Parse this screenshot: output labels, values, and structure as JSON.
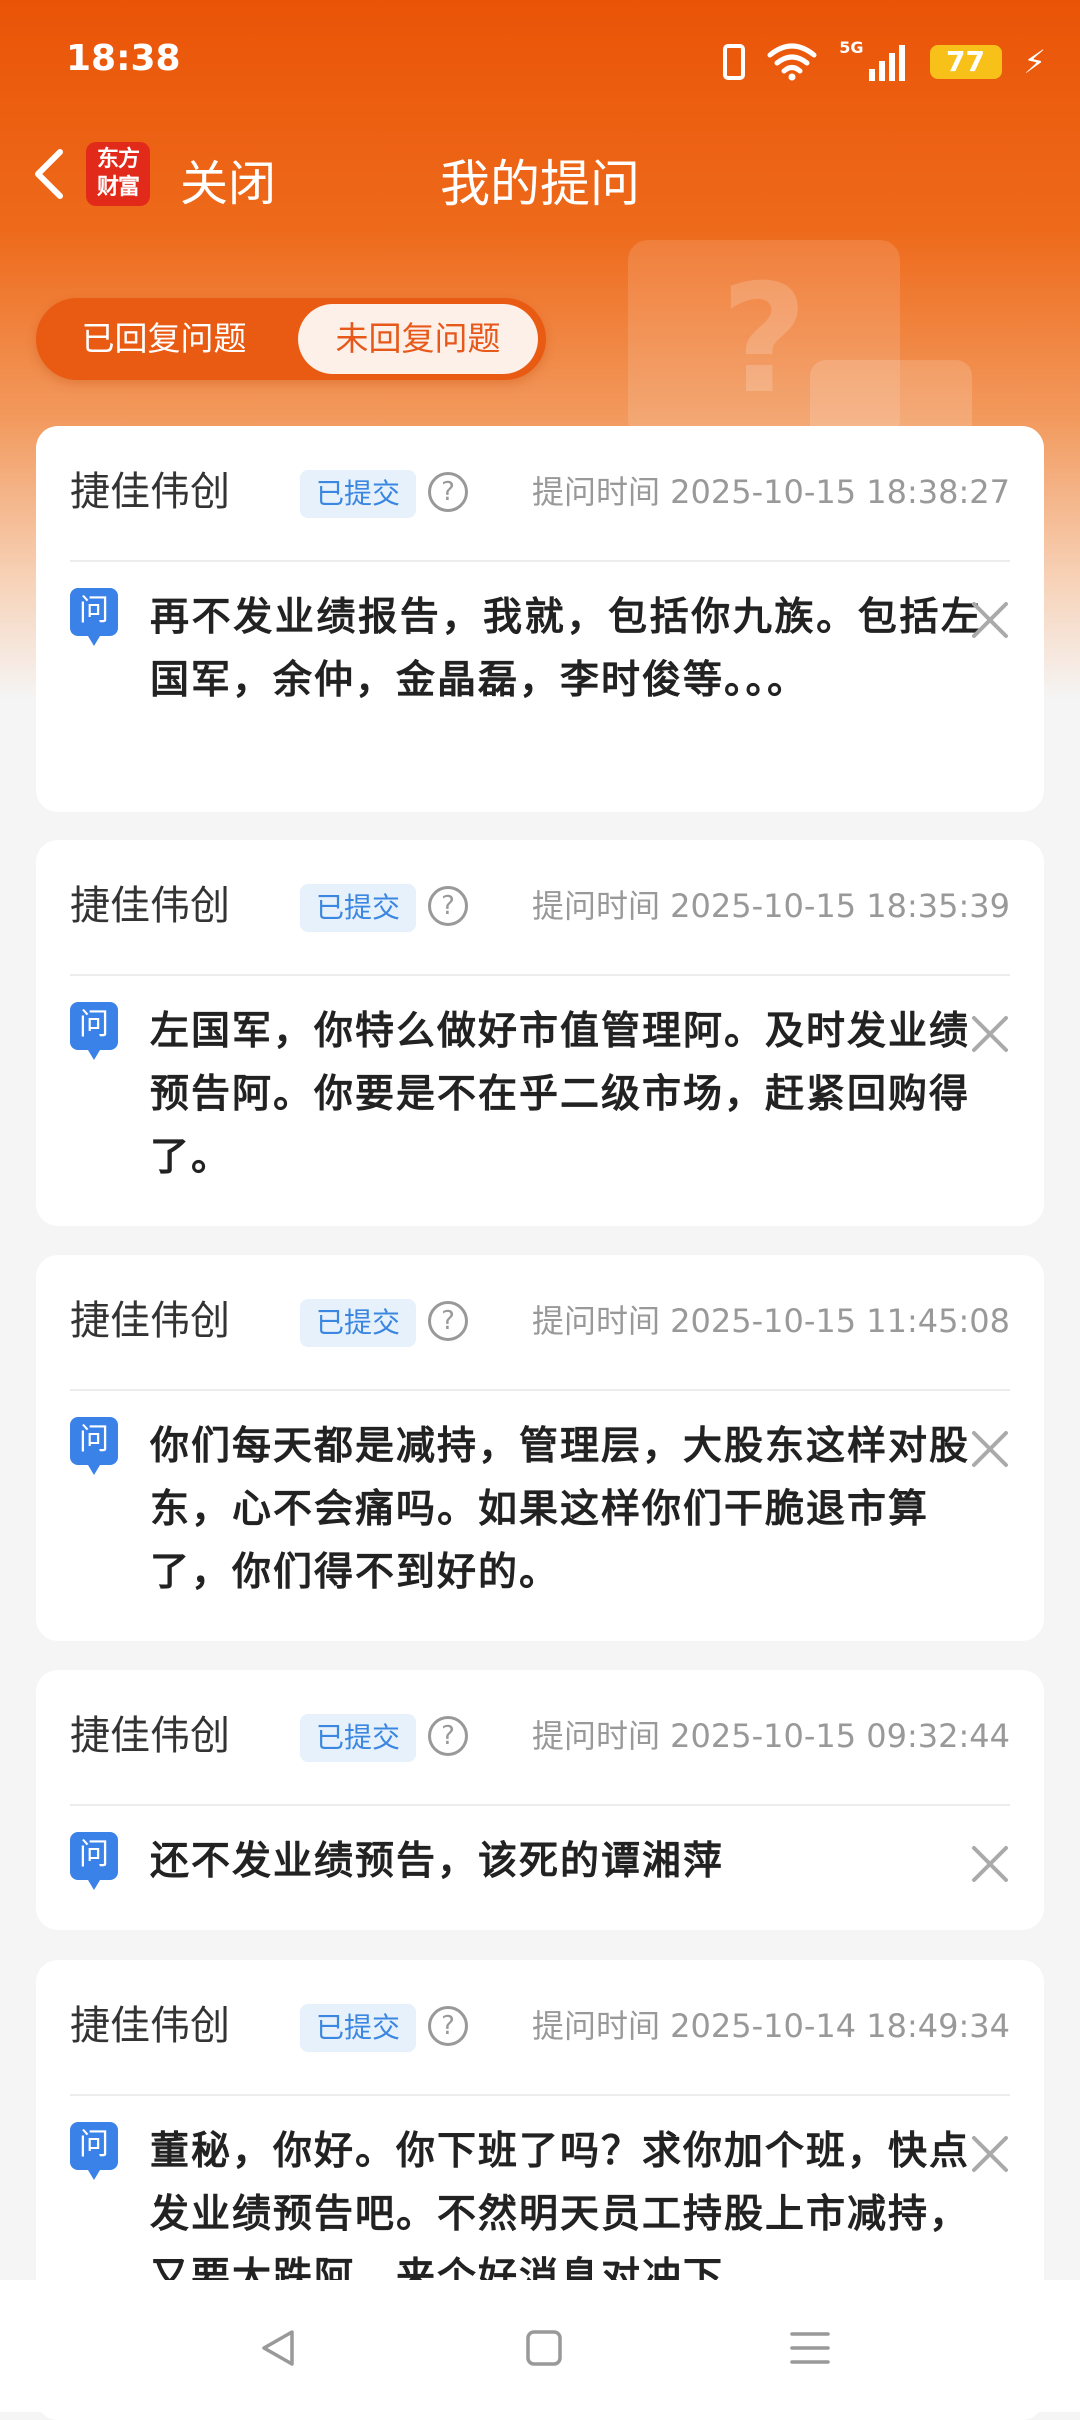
{
  "status_bar": {
    "time": "18:38",
    "network": "5G",
    "battery": "77",
    "icons": [
      "vibrate-icon",
      "wifi-icon",
      "signal-icon",
      "battery-icon",
      "charging-icon"
    ]
  },
  "header": {
    "logo_line1": "东方",
    "logo_line2": "财富",
    "close_label": "关闭",
    "title": "我的提问"
  },
  "tabs": {
    "answered": "已回复问题",
    "unanswered": "未回复问题",
    "active": "unanswered"
  },
  "questions": [
    {
      "company": "捷佳伟创",
      "status": "已提交",
      "time": "提问时间 2025-10-15 18:38:27",
      "icon_label": "问",
      "text": "再不发业绩报告，我就，包括你九族。包括左国军，余仲，金晶磊，李时俊等。。。"
    },
    {
      "company": "捷佳伟创",
      "status": "已提交",
      "time": "提问时间 2025-10-15 18:35:39",
      "icon_label": "问",
      "text": "左国军，你特么做好市值管理阿。及时发业绩预告阿。你要是不在乎二级市场，赶紧回购得了。"
    },
    {
      "company": "捷佳伟创",
      "status": "已提交",
      "time": "提问时间 2025-10-15 11:45:08",
      "icon_label": "问",
      "text": "你们每天都是减持，管理层，大股东这样对股东，心不会痛吗。如果这样你们干脆退市算了，你们得不到好的。"
    },
    {
      "company": "捷佳伟创",
      "status": "已提交",
      "time": "提问时间 2025-10-15 09:32:44",
      "icon_label": "问",
      "text": "还不发业绩预告，该死的谭湘萍"
    },
    {
      "company": "捷佳伟创",
      "status": "已提交",
      "time": "提问时间 2025-10-14 18:49:34",
      "icon_label": "问",
      "text": "董秘，你好。你下班了吗？求你加个班，快点发业绩预告吧。不然明天员工持股上市减持，又要大跌阿，来个好消息对冲下"
    }
  ],
  "colors": {
    "brand_orange": "#ea5407",
    "badge_blue": "#3a86e0",
    "question_icon_blue": "#3b82e8"
  }
}
